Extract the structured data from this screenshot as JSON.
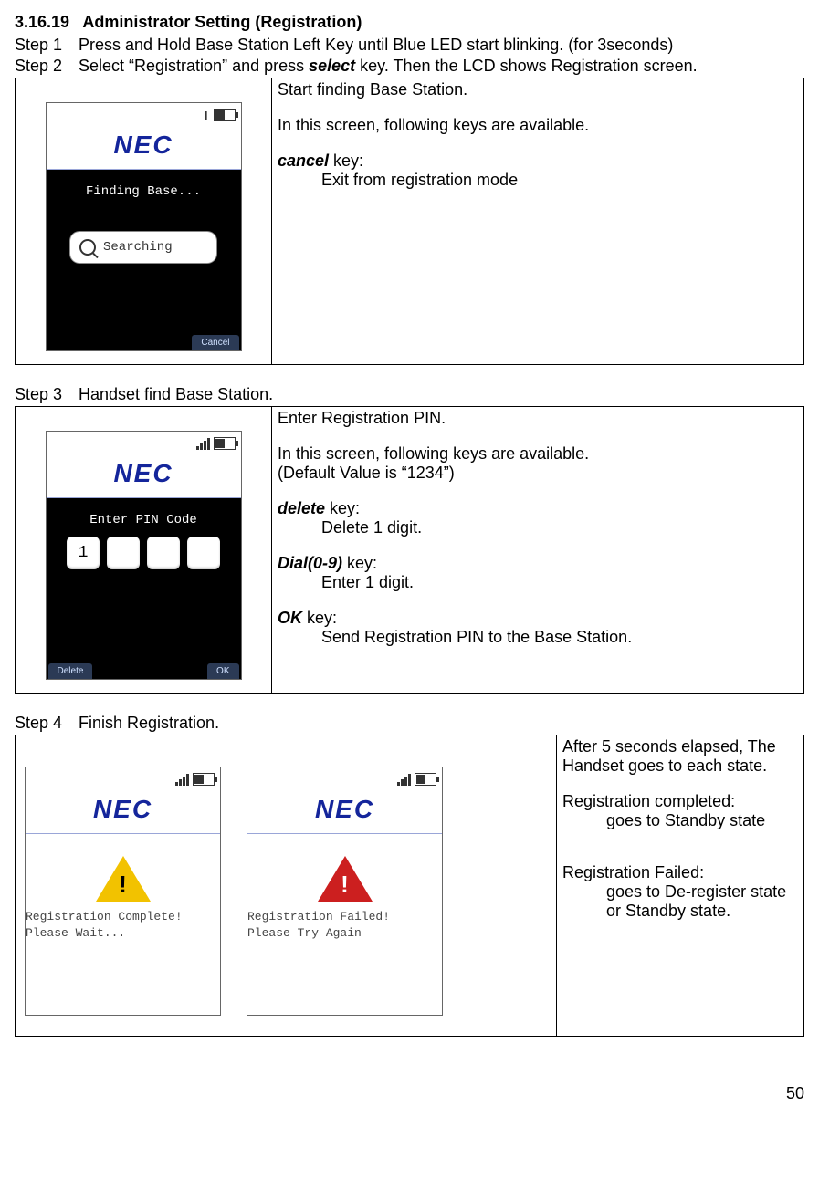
{
  "section": {
    "number": "3.16.19",
    "title": "Administrator Setting (Registration)"
  },
  "steps": {
    "s1": {
      "label": "Step 1",
      "text_a": "Press and Hold Base Station Left Key until Blue LED start blinking. (for 3seconds)"
    },
    "s2": {
      "label": "Step 2",
      "text_a": "Select “Registration” and press ",
      "key": "select",
      "text_b": " key. Then the LCD shows Registration screen."
    },
    "s3": {
      "label": "Step 3",
      "text_a": "Handset find Base Station."
    },
    "s4": {
      "label": "Step 4",
      "text_a": "Finish Registration."
    }
  },
  "panel1": {
    "line1": "Start finding Base Station.",
    "line2": "In this screen, following keys are available.",
    "key1_name": "cancel",
    "key1_suffix": " key:",
    "key1_desc": "Exit from registration mode"
  },
  "panel2": {
    "line1": "Enter Registration PIN.",
    "line2": "In this screen, following keys are available.",
    "line3": "(Default Value is “1234”)",
    "key1_name": "delete",
    "key1_suffix": " key:",
    "key1_desc": "Delete 1 digit.",
    "key2_name": "Dial(0-9)",
    "key2_suffix": " key:",
    "key2_desc": "Enter 1 digit.",
    "key3_name": "OK",
    "key3_suffix": " key:",
    "key3_desc": "Send Registration PIN to the Base Station."
  },
  "panel3": {
    "line1a": "After 5 seconds elapsed, The",
    "line1b": "Handset goes to each state.",
    "h1": "Registration completed:",
    "d1": "goes to Standby state",
    "h2": "Registration Failed:",
    "d2a": "goes to De-register state",
    "d2b": " or Standby state."
  },
  "phone": {
    "brand": "NEC",
    "nosignal": "I",
    "finding": "Finding Base...",
    "searching": "Searching",
    "softkey_cancel": "Cancel",
    "softkey_delete": "Delete",
    "softkey_ok": "OK",
    "enter_pin": "Enter PIN Code",
    "pin_digit1": "1",
    "reg_complete_l1": "Registration Complete!",
    "reg_complete_l2": "Please Wait...",
    "reg_failed_l1": "Registration Failed!",
    "reg_failed_l2": "Please Try Again",
    "bang": "!"
  },
  "page_number": "50"
}
